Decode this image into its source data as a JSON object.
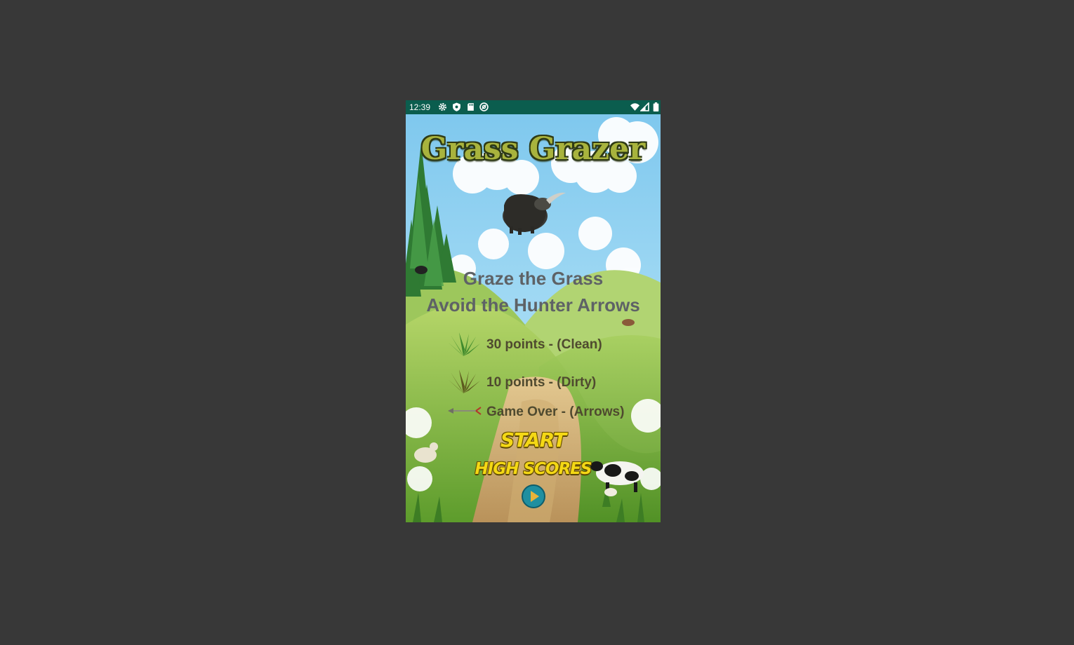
{
  "status_bar": {
    "time": "12:39",
    "icons": [
      "settings-icon",
      "shield-icon",
      "sd-card-icon",
      "at-sign-icon",
      "wifi-icon",
      "signal-icon",
      "battery-icon"
    ]
  },
  "game": {
    "title": "Grass Grazer",
    "instructions": {
      "line1": "Graze the Grass",
      "line2": "Avoid the Hunter Arrows"
    },
    "legend": [
      {
        "icon": "clean-grass-icon",
        "text": "30 points - (Clean)"
      },
      {
        "icon": "dirty-grass-icon",
        "text": "10 points - (Dirty)"
      },
      {
        "icon": "arrow-icon",
        "text": "Game Over - (Arrows)"
      }
    ],
    "buttons": {
      "start": "START",
      "high_scores": "HIGH SCORES",
      "play": "play-icon"
    }
  },
  "colors": {
    "page_background": "#383838",
    "status_bar": "#0b5d4e",
    "title": "#a8b33d",
    "button_text": "#f4d815",
    "play_button": "#1f8fa0"
  }
}
